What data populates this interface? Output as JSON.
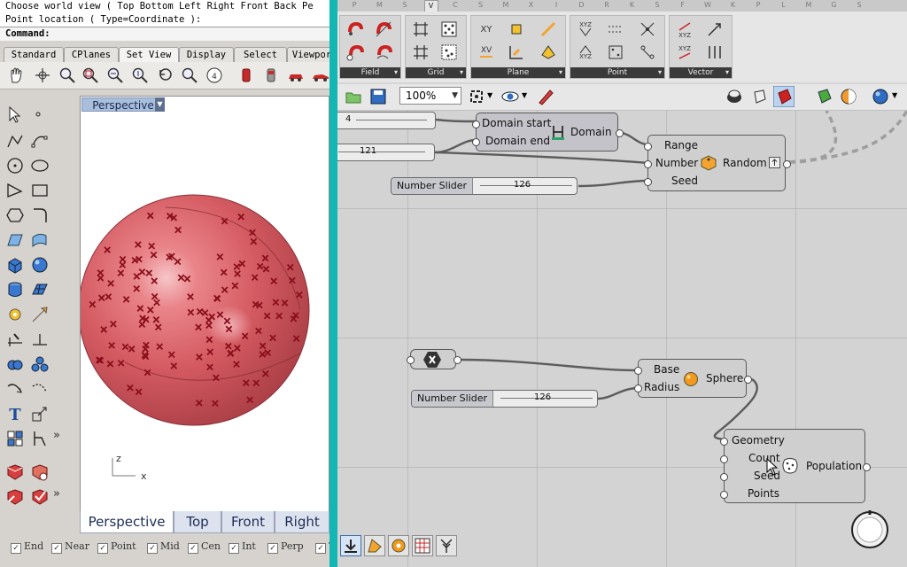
{
  "rhino": {
    "command_lines": [
      "Choose world view ( Top  Bottom  Left  Right  Front  Back  Pe",
      "Point location ( Type=Coordinate ):"
    ],
    "command_prompt": "Command:",
    "toolbar_tabs": [
      "Standard",
      "CPlanes",
      "Set View",
      "Display",
      "Select",
      "Viewpor"
    ],
    "active_toolbar_tab": "Set View",
    "viewport": {
      "title": "Perspective",
      "axis_z": "z",
      "axis_x": "x",
      "sphere_color": "#d4545c",
      "point_color": "#8b0f1c"
    },
    "viewport_tabs": [
      "Perspective",
      "Top",
      "Front",
      "Right"
    ],
    "active_viewport_tab": "Perspective",
    "osnaps": [
      "End",
      "Near",
      "Point",
      "Mid",
      "Cen",
      "Int",
      "Perp",
      "T"
    ]
  },
  "grasshopper": {
    "tabs": [
      "P",
      "M",
      "S",
      "V",
      "C",
      "S",
      "M",
      "X",
      "I",
      "D",
      "R",
      "K",
      "S",
      "F",
      "W",
      "K",
      "P",
      "L",
      "M",
      "G",
      "S"
    ],
    "active_tab": "V",
    "panels": [
      "Field",
      "Grid",
      "Plane",
      "Point",
      "Vector"
    ],
    "zoom": "100%",
    "accent_color": "#12b6b3",
    "components": {
      "slider_top1": {
        "value": "4"
      },
      "slider_top2": {
        "value": "121"
      },
      "domain": {
        "inputs": [
          "Domain start",
          "Domain end"
        ],
        "name": "Domain"
      },
      "random": {
        "inputs": [
          "Range",
          "Number",
          "Seed"
        ],
        "name": "Random"
      },
      "slider_seed": {
        "name": "Number Slider",
        "value": "126"
      },
      "sphere": {
        "inputs": [
          "Base",
          "Radius"
        ],
        "name": "Sphere"
      },
      "slider_radius": {
        "name": "Number Slider",
        "value": "126"
      },
      "population": {
        "inputs": [
          "Geometry",
          "Count",
          "Seed",
          "Points"
        ],
        "name": "Population"
      }
    }
  }
}
